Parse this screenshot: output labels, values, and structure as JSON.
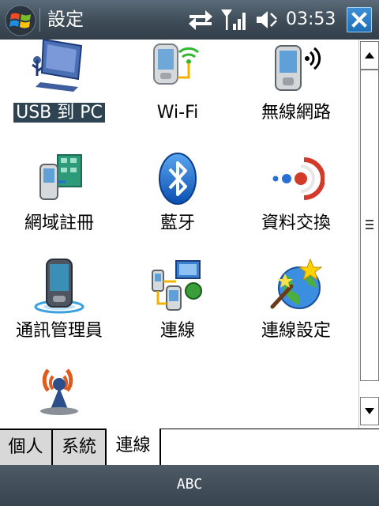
{
  "titlebar": {
    "title": "設定",
    "clock": "03:53"
  },
  "items": [
    {
      "label": "USB 到 PC",
      "icon": "usb-to-pc-icon",
      "selected": true
    },
    {
      "label": "Wi-Fi",
      "icon": "wifi-icon"
    },
    {
      "label": "無線網路",
      "icon": "wireless-manager-icon"
    },
    {
      "label": "網域註冊",
      "icon": "domain-enroll-icon"
    },
    {
      "label": "藍牙",
      "icon": "bluetooth-icon"
    },
    {
      "label": "資料交換",
      "icon": "beam-icon"
    },
    {
      "label": "通訊管理員",
      "icon": "comm-manager-icon"
    },
    {
      "label": "連線",
      "icon": "connections-icon"
    },
    {
      "label": "連線設定",
      "icon": "connection-setup-icon"
    },
    {
      "label": "",
      "icon": "network-cards-icon"
    }
  ],
  "tabs": [
    {
      "label": "個人"
    },
    {
      "label": "系統"
    },
    {
      "label": "連線",
      "active": true
    }
  ],
  "sip": {
    "label": "ABC"
  }
}
